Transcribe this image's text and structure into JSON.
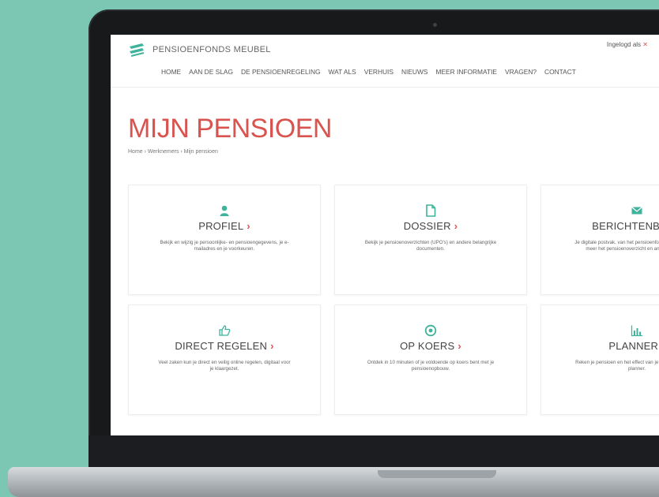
{
  "site": {
    "logo_text": "PENSIOENFONDS MEUBEL",
    "logged_in": "Ingelogd als"
  },
  "nav": [
    "HOME",
    "AAN DE SLAG",
    "DE PENSIOENREGELING",
    "WAT ALS",
    "VERHUIS",
    "NIEUWS",
    "MEER INFORMATIE",
    "VRAGEN?",
    "CONTACT"
  ],
  "page": {
    "title": "MIJN PENSIOEN",
    "breadcrumb": "Home › Werknemers › Mijn pensioen"
  },
  "cards": [
    {
      "title": "PROFIEL",
      "desc": "Bekijk en wijzig je persoonlijke- en pensioengegevens, je e-mailadres en je voorkeuren.",
      "icon": "user-icon"
    },
    {
      "title": "DOSSIER",
      "desc": "Bekijk je pensioenoverzichten (UPO's) en andere belangrijke documenten.",
      "icon": "document-icon"
    },
    {
      "title": "BERICHTENBOX",
      "desc": "Je digitale postvak, van het pensioenfonds voor je zonder meer het pensioenoverzicht en ander berichten",
      "icon": "envelope-icon"
    },
    {
      "title": "DIRECT REGELEN",
      "desc": "Veel zaken kun je direct en veilig online regelen, digitaal voor je klaargezet.",
      "icon": "thumbs-up-icon"
    },
    {
      "title": "OP KOERS",
      "desc": "Ontdek in 10 minuten of je voldoende op koers bent met je pensioenopbouw.",
      "icon": "target-icon"
    },
    {
      "title": "PLANNER",
      "desc": "Reken je pensioen en het effect van je keuzes door in de planner.",
      "icon": "chart-icon"
    }
  ],
  "colors": {
    "accent_red": "#d9534f",
    "accent_teal": "#3fb39b",
    "background": "#7cc7b3"
  }
}
